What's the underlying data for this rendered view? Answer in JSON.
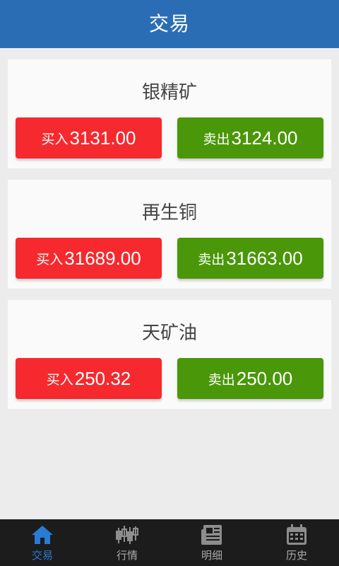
{
  "header": {
    "title": "交易"
  },
  "products": [
    {
      "name": "银精矿",
      "buy_label": "买入",
      "buy_price": "3131.00",
      "sell_label": "卖出",
      "sell_price": "3124.00"
    },
    {
      "name": "再生铜",
      "buy_label": "买入",
      "buy_price": "31689.00",
      "sell_label": "卖出",
      "sell_price": "31663.00"
    },
    {
      "name": "天矿油",
      "buy_label": "买入",
      "buy_price": "250.32",
      "sell_label": "卖出",
      "sell_price": "250.00"
    }
  ],
  "tabs": [
    {
      "label": "交易",
      "icon": "home-icon",
      "active": true
    },
    {
      "label": "行情",
      "icon": "candlestick-icon",
      "active": false
    },
    {
      "label": "明细",
      "icon": "newspaper-icon",
      "active": false
    },
    {
      "label": "历史",
      "icon": "calendar-icon",
      "active": false
    }
  ],
  "colors": {
    "header": "#2a6db5",
    "buy": "#f5292e",
    "sell": "#4a9709",
    "tab_active": "#2a7bd4",
    "tab_inactive": "#a9a9a9"
  }
}
